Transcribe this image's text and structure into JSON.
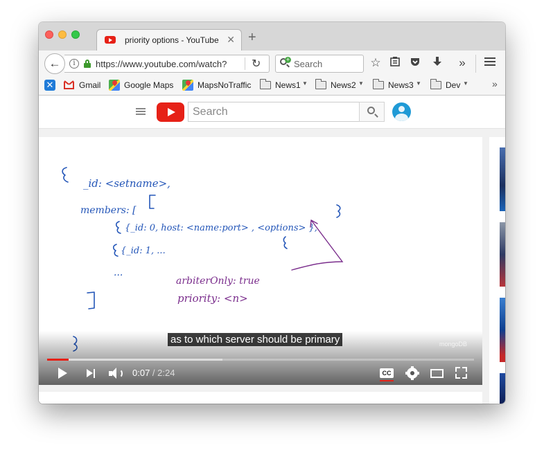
{
  "browser": {
    "tab": {
      "title": "priority options - YouTube"
    },
    "url": "https://www.youtube.com/watch?",
    "search_placeholder": "Search",
    "bookmarks": [
      {
        "label": "Gmail",
        "icon": "gmail-icon"
      },
      {
        "label": "Google Maps",
        "icon": "maps-icon"
      },
      {
        "label": "MapsNoTraffic",
        "icon": "maps-icon"
      },
      {
        "label": "News1",
        "icon": "folder-icon"
      },
      {
        "label": "News2",
        "icon": "folder-icon"
      },
      {
        "label": "News3",
        "icon": "folder-icon"
      },
      {
        "label": "Dev",
        "icon": "folder-icon"
      }
    ]
  },
  "youtube": {
    "search_placeholder": "Search",
    "video": {
      "caption": "as to which server should be primary",
      "watermark": "mongoDB",
      "current_time": "0:07",
      "separator": " / ",
      "duration": "2:24",
      "played_fraction": 0.05,
      "buffered_fraction": 0.41,
      "whiteboard": {
        "lines": [
          "{",
          "_id: <setname>,",
          "members: [",
          "{_id: 0, host: <name:port> , <options> },",
          "{_id: 1, ...",
          "{ ,",
          "...",
          "]",
          "}",
          "arbiterOnly: true",
          "priority: <n>"
        ],
        "colors": {
          "blue_ink": "#2456b8",
          "purple_ink": "#7a2d8c"
        }
      }
    }
  },
  "colors": {
    "accent": "#e62117",
    "chrome_bg": "#f5f5f5"
  }
}
